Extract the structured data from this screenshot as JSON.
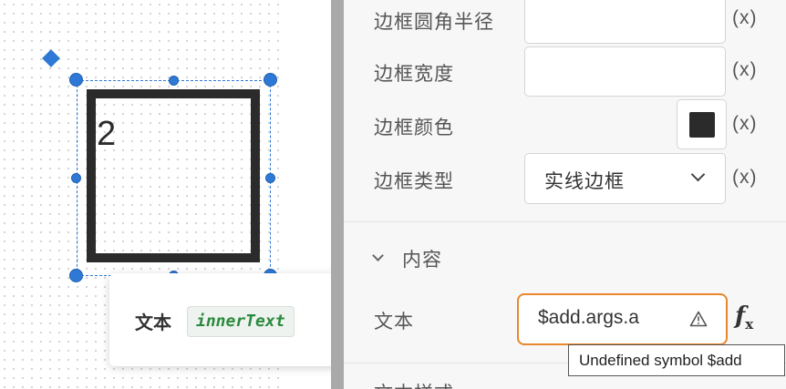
{
  "canvas": {
    "component_text": "2",
    "tooltip": {
      "label": "文本",
      "code": "innerText"
    }
  },
  "panel": {
    "properties": [
      {
        "label": "边框圆角半径",
        "value": "",
        "x": "(x)"
      },
      {
        "label": "边框宽度",
        "value": "",
        "x": "(x)"
      },
      {
        "label": "边框颜色",
        "color": "#2b2b2b",
        "x": "(x)"
      },
      {
        "label": "边框类型",
        "value": "实线边框",
        "x": "(x)"
      }
    ],
    "content_section": {
      "title": "内容",
      "text_label": "文本",
      "text_expression": "$add.args.a",
      "fx_label": "f",
      "fx_sub": "x",
      "error_tooltip": "Undefined symbol $add"
    },
    "next_label": "文本样式"
  },
  "colors": {
    "accent": "#2f79d6",
    "error_border": "#e8872b",
    "code_green": "#2b8a3e"
  }
}
